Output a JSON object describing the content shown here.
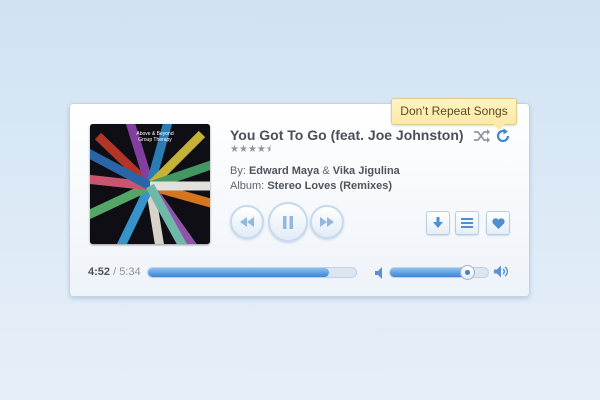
{
  "tooltip": {
    "text": "Don’t Repeat Songs"
  },
  "track": {
    "title": "You Got To Go (feat. Joe Johnston)",
    "rating": 4.5,
    "rating_max": 5,
    "artist_label": "By:",
    "artists": [
      "Edward Maya",
      "Vika Jigulina"
    ],
    "artist_separator": "&",
    "album_label": "Album:",
    "album": "Stereo Loves (Remixes)"
  },
  "album_art": {
    "caption": "Above & Beyond Group Therapy"
  },
  "time": {
    "current": "4:52",
    "separator": "/",
    "total": "5:34"
  },
  "progress": {
    "fraction": 0.87
  },
  "volume": {
    "fraction": 0.8
  },
  "icons": {
    "shuffle": "shuffle-icon",
    "repeat": "repeat-icon",
    "rewind": "rewind-icon",
    "pause": "pause-icon",
    "fast_forward": "fast-forward-icon",
    "download": "download-icon",
    "playlist": "playlist-icon",
    "love": "heart-icon",
    "volume_low": "volume-low-icon",
    "volume_high": "volume-high-icon"
  },
  "colors": {
    "accent": "#3c84d4",
    "tooltip_bg": "#fbe9a6"
  }
}
